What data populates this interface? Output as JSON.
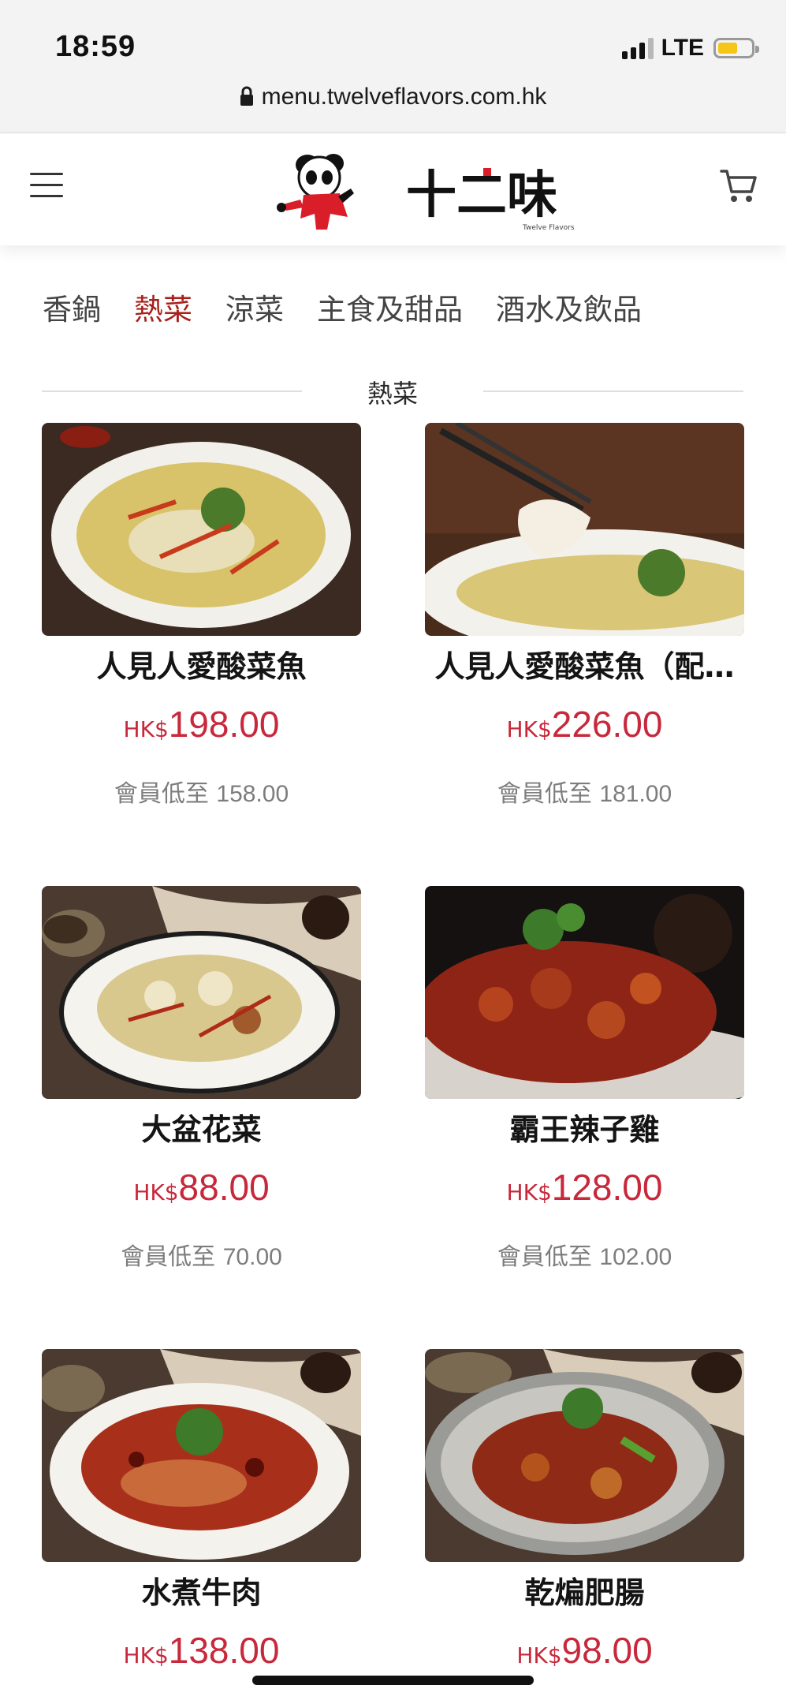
{
  "status_bar": {
    "time": "18:59",
    "network": "LTE",
    "battery_level": 0.6
  },
  "browser": {
    "url": "menu.twelveflavors.com.hk"
  },
  "header": {
    "logo_text": "十二味",
    "logo_subtitle": "Twelve Flavors"
  },
  "tabs": [
    {
      "label": "香鍋",
      "active": false
    },
    {
      "label": "熱菜",
      "active": true
    },
    {
      "label": "涼菜",
      "active": false
    },
    {
      "label": "主食及甜品",
      "active": false
    },
    {
      "label": "酒水及飲品",
      "active": false
    }
  ],
  "section": {
    "title": "熱菜"
  },
  "currency": "HK$",
  "member_label": "會員低至",
  "items": [
    {
      "name": "人見人愛酸菜魚",
      "price": "198.00",
      "member_price": "158.00"
    },
    {
      "name": "人見人愛酸菜魚（配…",
      "price": "226.00",
      "member_price": "181.00"
    },
    {
      "name": "大盆花菜",
      "price": "88.00",
      "member_price": "70.00"
    },
    {
      "name": "霸王辣子雞",
      "price": "128.00",
      "member_price": "102.00"
    },
    {
      "name": "水煮牛肉",
      "price": "138.00",
      "member_price": ""
    },
    {
      "name": "乾煸肥腸",
      "price": "98.00",
      "member_price": ""
    }
  ],
  "colors": {
    "accent": "#a8201a",
    "price": "#c8283b",
    "muted": "#7d7d7d"
  }
}
